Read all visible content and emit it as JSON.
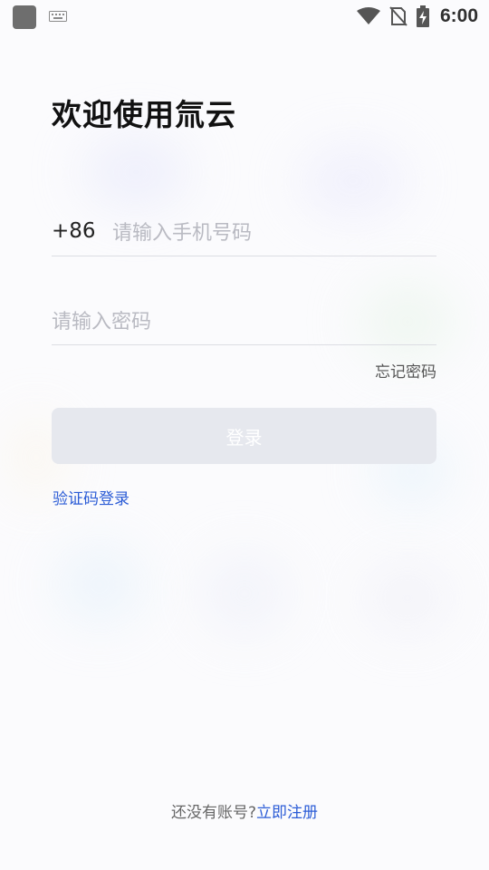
{
  "status_bar": {
    "time": "6:00",
    "icons": [
      "app-icon",
      "keyboard-icon",
      "wifi-icon",
      "no-sim-icon",
      "battery-charging-icon"
    ]
  },
  "login": {
    "title": "欢迎使用氚云",
    "country_code": "+86",
    "phone_placeholder": "请输入手机号码",
    "password_placeholder": "请输入密码",
    "forgot_password": "忘记密码",
    "login_button": "登录",
    "sms_code_login": "验证码登录",
    "no_account_prompt": "还没有账号?",
    "register_link": "立即注册"
  },
  "colors": {
    "accent": "#2b5cd6",
    "button_disabled": "#e6e8ee",
    "title": "#111111",
    "placeholder": "#b9bac2"
  }
}
